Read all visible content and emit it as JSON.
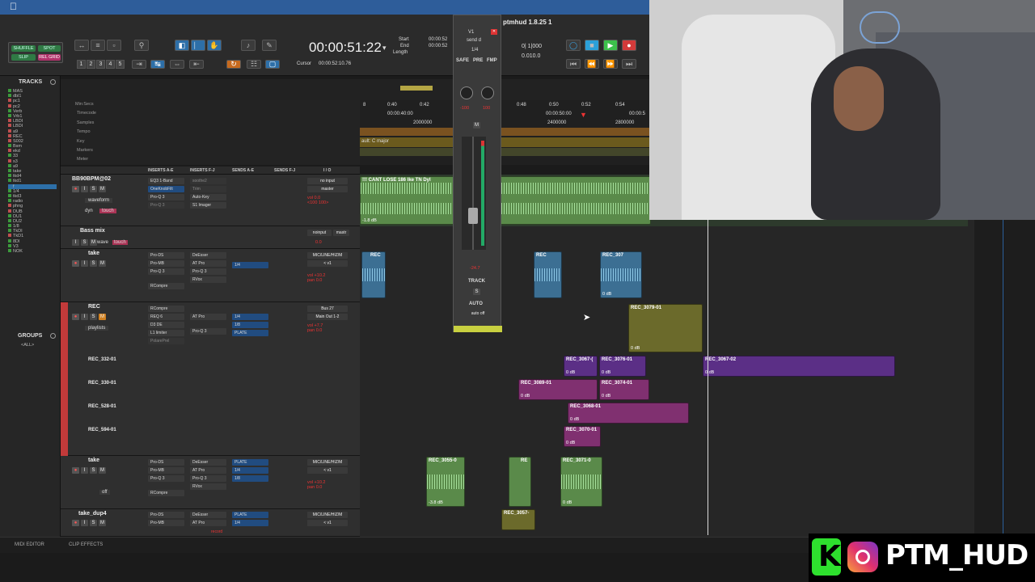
{
  "app": {
    "title": "ptmhud 1.8.25 1"
  },
  "transport": {
    "counter": "00:00:51:22",
    "counter_arrow": "▾",
    "start_label": "Start",
    "end_label": "End",
    "length_label": "Length",
    "start_val": "00:00:52",
    "end_val": "00:00:52",
    "cursor_label": "Cursor",
    "cursor_val": "00:00:52:10.76",
    "tempo_val": "0| 1|000",
    "tempo2": "0.010.0"
  },
  "modes": {
    "shuffle": "SHUFFLE",
    "spot": "SPOT",
    "slip": "SLIP",
    "rel_grid": "REL GRID"
  },
  "num_buttons": [
    "1",
    "2",
    "3",
    "4",
    "5"
  ],
  "tracks_panel": {
    "title": "TRACKS",
    "items": [
      "MAS",
      "dbl1",
      "pc1",
      "pc2",
      "Verb",
      "Vrb1",
      "LBDI",
      "LBDI",
      "a9",
      "REC",
      "S002",
      "Bsm",
      "ekd",
      "33",
      "s3",
      "a9",
      "take",
      "tkd4",
      "tkd1",
      "f",
      "1/4",
      "tkd3",
      "radio",
      "phng",
      "DUB",
      "DU1",
      "DU2",
      "1/8",
      "TkDI",
      "TkD1",
      "8DI",
      "V3",
      "NOK"
    ],
    "groups_title": "GROUPS",
    "groups_all": "<ALL>"
  },
  "rulers": [
    "Min:Secs",
    "Timecode",
    "Samples",
    "Tempo",
    "Key",
    "Markers",
    "Meter"
  ],
  "ruler_values": {
    "t1": "0:40",
    "t2": "0:42",
    "t3": "0:48",
    "t4": "0:50",
    "t5": "0:52",
    "t6": "0:54",
    "tc1": "00:00:40:00",
    "tc2": "00:00:50:00",
    "tc3": "00:00:5",
    "s1": "2000000",
    "s2": "2400000",
    "s3": "2800000",
    "key": "ault: C major"
  },
  "columns": {
    "inserts_ae": "INSERTS A-E",
    "inserts_fj": "INSERTS F-J",
    "sends_ae": "SENDS A-E",
    "sends_fj": "SENDS F-J",
    "io": "I / O"
  },
  "track1": {
    "name": "BB90BPM@02",
    "ins": [
      "EQ3 1-Band",
      "OneKnobFilt",
      "Pro-Q 3",
      "Pro-Q 3"
    ],
    "ins2": [
      "soothe2",
      "Trim",
      "Auto-Key",
      "S1 Imager"
    ],
    "io": [
      "no input",
      "master"
    ],
    "vol": "vol 0.0",
    "pan": "<100 100>",
    "view": "waveform",
    "dyn": "dyn",
    "mode": "touch",
    "clip": "!!! CANT LOSE 186 lke TN Dyl"
  },
  "track2": {
    "name": "Bass mix",
    "io": "noinput",
    "io2": "mastr",
    "vol": "0.0",
    "wave": "wave",
    "mode": "touch"
  },
  "track3": {
    "name": "take",
    "ins": [
      "Pro-DS",
      "Pro-MB",
      "Pro-Q 3",
      "RCompre"
    ],
    "ins2": [
      "DeEsser",
      "AT Pro",
      "Pro-Q 3",
      "RVox"
    ],
    "send": "1/4",
    "io": [
      "MIC/LINE/HIZ/M",
      "< v1"
    ],
    "vol": "vol +10.2",
    "pan": "pan 0.0"
  },
  "track4": {
    "name": "REC",
    "ins": [
      "RCompre",
      "REQ 6",
      "D3 DE",
      "L1 limiter",
      "PolarePrel"
    ],
    "ins2": [
      "AT Pro",
      "Pro-Q 3"
    ],
    "sends": [
      "1/4",
      "1/8",
      "PLATE"
    ],
    "io": [
      "Bus 27",
      "Main Out 1-2"
    ],
    "vol": "vol +7.7",
    "pan": "pan 0.0",
    "view": "playlists"
  },
  "playlists": [
    "REC_332-01",
    "REC_330-01",
    "REC_528-01",
    "REC_594-01"
  ],
  "track5": {
    "name": "take",
    "ins": [
      "Pro-DS",
      "Pro-MB",
      "Pro-Q 3",
      "RCompre"
    ],
    "ins2": [
      "DeEsser",
      "AT Pro",
      "Pro-Q 3",
      "RVox"
    ],
    "sends": [
      "PLATE",
      "1/4",
      "1/8"
    ],
    "io": [
      "MIC/LINE/HIZ/M",
      "< v1"
    ],
    "vol": "vol +10.2",
    "pan": "pan 0.0",
    "mode": "off"
  },
  "track6": {
    "name": "take_dup4",
    "ins": [
      "Pro-DS",
      "Pro-MB"
    ],
    "ins2": [
      "DeEsser",
      "AT Pro"
    ],
    "sends": [
      "PLATE",
      "1/4"
    ],
    "io": [
      "MIC/LINE/HIZ/M",
      "< v1"
    ],
    "rec": "record"
  },
  "clips": {
    "top_gain": "-1.8 dB",
    "rec_a": "REC",
    "rec_b": "REC",
    "rec_c": "REC",
    "rec_d": "REC_307",
    "rec_e": "RE",
    "db0": "0 dB",
    "c3079": "REC_3079-01",
    "c3067a": "REC_3067-(",
    "c3076": "REC_3076-01",
    "c3067b": "REC_3067-02",
    "c3089": "REC_3089-01",
    "c3074": "REC_3074-01",
    "c3068": "REC_3068-01",
    "c3070": "REC_3070-01",
    "c3055": "REC_3055-0",
    "c_re": "RE",
    "c3071": "REC_3071-0",
    "c3057": "REC_3057-",
    "g38": "-3.8 dB"
  },
  "mixer": {
    "safe": "SAFE",
    "pre": "PRE",
    "fmp": "FMP",
    "v1": "V1",
    "send": "send d",
    "pan_l": "-100",
    "pan_r": "100",
    "m": "M",
    "vol": "-24.7",
    "track": "TRACK",
    "s": "S",
    "auto": "AUTO",
    "auto_mode": "auto off",
    "frac": "1/4"
  },
  "bottom": {
    "midi_editor": "MIDI EDITOR",
    "clip_effects": "CLIP EFFECTS"
  },
  "brand": {
    "text": "PTM_HUD"
  },
  "colors": {
    "accent_blue": "#2d6fa8",
    "track_red": "#d04040",
    "clip_green": "#5a8a4a",
    "clip_purple": "#5b2f86"
  }
}
